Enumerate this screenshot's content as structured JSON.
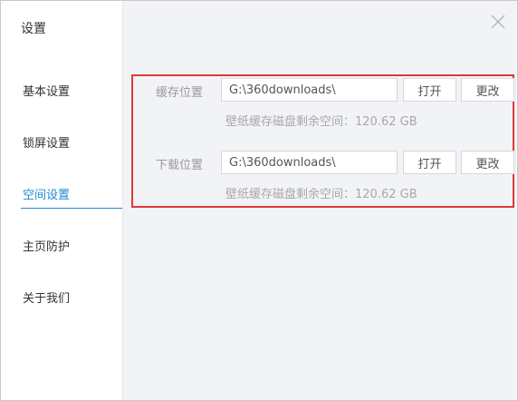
{
  "sidebar": {
    "title": "设置",
    "items": [
      {
        "label": "基本设置",
        "active": false
      },
      {
        "label": "锁屏设置",
        "active": false
      },
      {
        "label": "空间设置",
        "active": true
      },
      {
        "label": "主页防护",
        "active": false
      },
      {
        "label": "关于我们",
        "active": false
      }
    ]
  },
  "colors": {
    "accent": "#1c8ad3",
    "highlight_border": "#e0373b",
    "panel_background": "#f1f3f6"
  },
  "cache": {
    "label": "缓存位置",
    "path": "G:\\360downloads\\",
    "open_label": "打开",
    "change_label": "更改",
    "space_info": "壁纸缓存磁盘剩余空间：120.62  GB"
  },
  "download": {
    "label": "下载位置",
    "path": "G:\\360downloads\\",
    "open_label": "打开",
    "change_label": "更改",
    "space_info": "壁纸缓存磁盘剩余空间：120.62  GB"
  },
  "icons": {
    "close": "close-icon"
  }
}
